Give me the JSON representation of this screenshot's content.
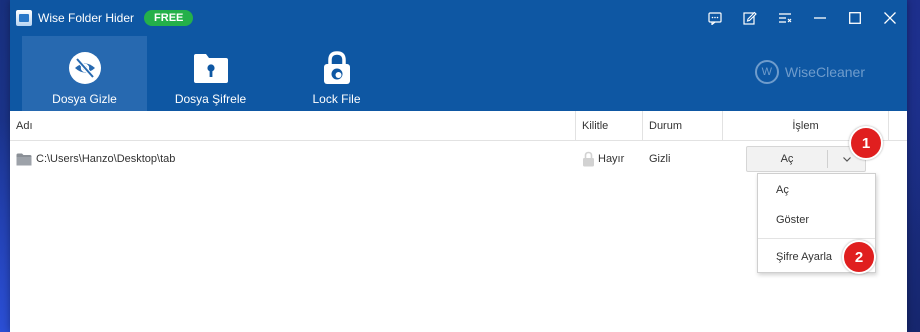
{
  "app": {
    "title": "Wise Folder Hider",
    "badge": "FREE",
    "brand": "WiseCleaner",
    "brand_logo_letter": "W",
    "colors": {
      "header_bg": "#0e57a3",
      "active_tab_bg": "#2769b0",
      "badge_bg": "#24b04a",
      "step_marker": "#e01f1f"
    }
  },
  "window_controls": [
    {
      "name": "feedback-icon"
    },
    {
      "name": "edit-icon"
    },
    {
      "name": "menu-icon"
    },
    {
      "name": "minimize-icon"
    },
    {
      "name": "maximize-icon"
    },
    {
      "name": "close-icon"
    }
  ],
  "toolbar": {
    "tabs": [
      {
        "label": "Dosya Gizle",
        "icon": "eye-slash-icon",
        "active": true
      },
      {
        "label": "Dosya Şifrele",
        "icon": "folder-lock-icon",
        "active": false
      },
      {
        "label": "Lock File",
        "icon": "padlock-icon",
        "active": false
      }
    ]
  },
  "table": {
    "columns": [
      "Adı",
      "Kilitle",
      "Durum",
      "İşlem"
    ],
    "rows": [
      {
        "path": "C:\\Users\\Hanzo\\Desktop\\tab",
        "locked": "Hayır",
        "status": "Gizli",
        "action": "Aç"
      }
    ]
  },
  "dropdown": {
    "items": [
      "Aç",
      "Göster",
      "Şifre Ayarla"
    ]
  },
  "markers": [
    "1",
    "2"
  ]
}
